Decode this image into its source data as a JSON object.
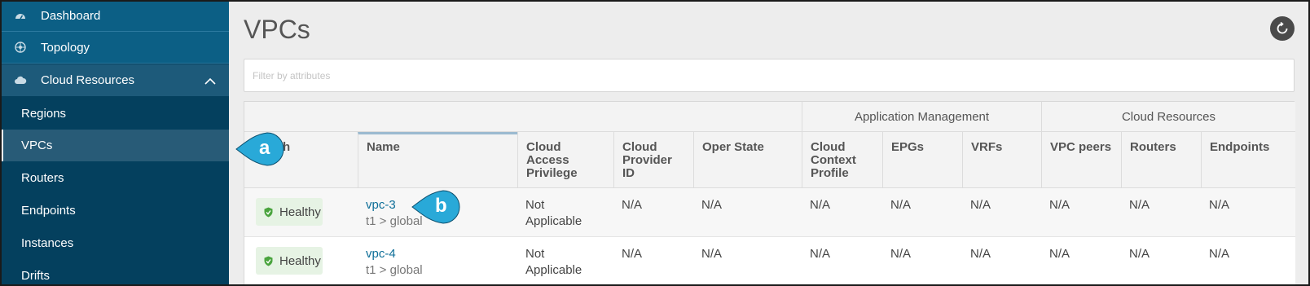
{
  "sidebar": {
    "items": [
      {
        "label": "Dashboard",
        "icon": "dashboard-icon"
      },
      {
        "label": "Topology",
        "icon": "topology-icon"
      },
      {
        "label": "Cloud Resources",
        "icon": "cloud-icon",
        "expanded": true
      },
      {
        "label": "Regions"
      },
      {
        "label": "VPCs",
        "active": true
      },
      {
        "label": "Routers"
      },
      {
        "label": "Endpoints"
      },
      {
        "label": "Instances"
      },
      {
        "label": "Drifts"
      }
    ]
  },
  "main": {
    "title": "VPCs",
    "refresh_icon": "refresh-icon",
    "filter_placeholder": "Filter by attributes"
  },
  "table": {
    "groups": [
      "Application Management",
      "Cloud Resources"
    ],
    "columns": [
      "Health",
      "Name",
      "Cloud Access Privilege",
      "Cloud Provider ID",
      "Oper State",
      "Cloud Context Profile",
      "EPGs",
      "VRFs",
      "VPC peers",
      "Routers",
      "Endpoints"
    ],
    "columns_visible_lines": {
      "health": "th",
      "cloud_access": [
        "Cloud Access",
        "Privilege"
      ],
      "cloud_provider": [
        "Cloud",
        "Provider ID"
      ],
      "cloud_context": [
        "Cloud",
        "Context",
        "Profile"
      ]
    },
    "rows": [
      {
        "health": "Healthy",
        "name": "vpc-3",
        "path": "t1 > global",
        "cloud_access": [
          "Not",
          "Applicable"
        ],
        "cloud_provider_id": "N/A",
        "oper_state": "N/A",
        "cloud_context_profile": "N/A",
        "epgs": "N/A",
        "vrfs": "N/A",
        "vpc_peers": "N/A",
        "routers": "N/A",
        "endpoints": "N/A"
      },
      {
        "health": "Healthy",
        "name": "vpc-4",
        "path": "t1 > global",
        "cloud_access": [
          "Not",
          "Applicable"
        ],
        "cloud_provider_id": "N/A",
        "oper_state": "N/A",
        "cloud_context_profile": "N/A",
        "epgs": "N/A",
        "vrfs": "N/A",
        "vpc_peers": "N/A",
        "routers": "N/A",
        "endpoints": "N/A"
      }
    ]
  },
  "callouts": {
    "a": "a",
    "b": "b"
  },
  "colors": {
    "sidebar": "#04405e",
    "sidebar_top": "#0c5f85",
    "link": "#0d6e98",
    "callout": "#29a9d8",
    "healthy_bg": "#e6f3e4",
    "healthy_icon": "#4aa43e"
  }
}
